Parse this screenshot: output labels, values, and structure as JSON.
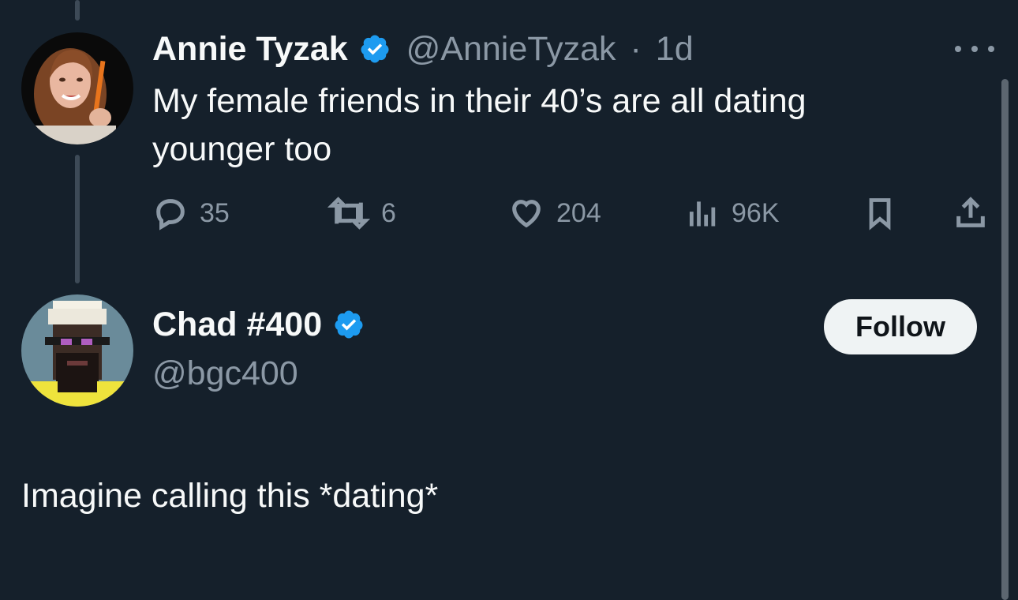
{
  "original_tweet": {
    "author_name": "Annie Tyzak",
    "author_handle": "@AnnieTyzak",
    "separator": "·",
    "time": "1d",
    "text_line1": "My female friends in their 40’s are all dating",
    "text_line2": "younger too",
    "replies": "35",
    "retweets": "6",
    "likes": "204",
    "views": "96K",
    "icons": [
      "reply-icon",
      "retweet-icon",
      "like-icon",
      "views-icon",
      "bookmark-icon",
      "share-icon",
      "more-icon",
      "verified-badge-icon"
    ]
  },
  "reply_tweet": {
    "author_name": "Chad #400",
    "author_handle": "@bgc400",
    "follow_label": "Follow",
    "text": "Imagine calling this *dating*"
  },
  "colors": {
    "background": "#15202b",
    "text_primary": "#f7f9f9",
    "text_secondary": "#8b98a5",
    "verified": "#1d9bf0",
    "follow_bg": "#eff3f4"
  }
}
